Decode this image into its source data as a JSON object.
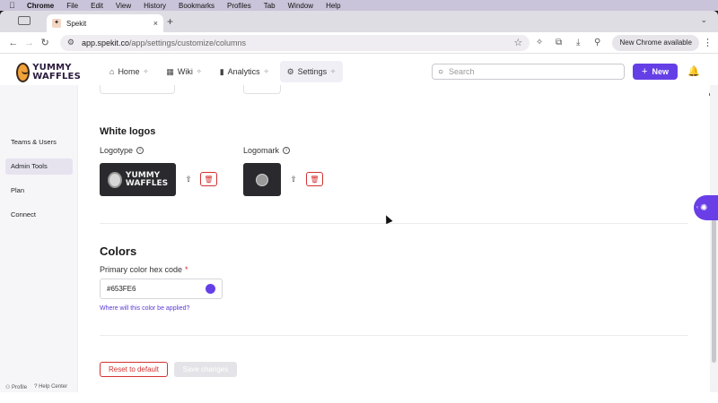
{
  "menubar": {
    "items": [
      "Chrome",
      "File",
      "Edit",
      "View",
      "History",
      "Bookmarks",
      "Profiles",
      "Tab",
      "Window",
      "Help"
    ]
  },
  "browser": {
    "tab_title": "Spekit",
    "url_host": "app.spekit.co",
    "url_path": "/app/settings/customize/columns",
    "update_label": "New Chrome available"
  },
  "header": {
    "brand_line1": "YUMMY",
    "brand_line2": "WAFFLES",
    "nav": [
      {
        "label": "Home",
        "icon": "home-icon"
      },
      {
        "label": "Wiki",
        "icon": "wiki-icon"
      },
      {
        "label": "Analytics",
        "icon": "analytics-icon"
      },
      {
        "label": "Settings",
        "icon": "gear-icon"
      }
    ],
    "search_placeholder": "Search",
    "new_label": "New"
  },
  "sidebar": {
    "items": [
      "Teams & Users",
      "Admin Tools",
      "Plan",
      "Connect"
    ],
    "active": "Admin Tools",
    "footer_profile": "Profile",
    "footer_help": "Help Center"
  },
  "white_logos": {
    "title": "White logos",
    "logotype_label": "Logotype",
    "logotype_line1": "YUMMY",
    "logotype_line2": "WAFFLES",
    "logomark_label": "Logomark"
  },
  "colors": {
    "title": "Colors",
    "primary_label": "Primary color hex code",
    "required_mark": "*",
    "hex_value": "#653FE6",
    "swatch_color": "#653FE6",
    "help_link": "Where will this color be applied?"
  },
  "actions": {
    "reset_label": "Reset to default",
    "save_label": "Save changes"
  }
}
